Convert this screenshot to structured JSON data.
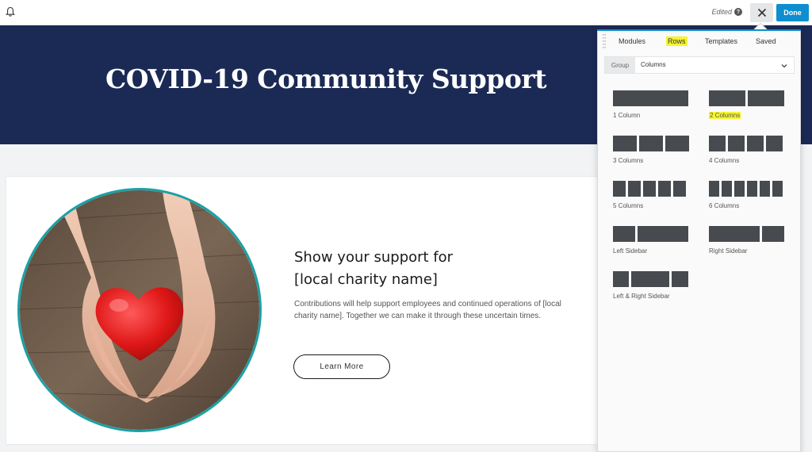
{
  "topbar": {
    "edited_label": "Edited",
    "help_glyph": "?",
    "done_label": "Done",
    "icons": [
      "bell-icon",
      "help-icon",
      "close-icon"
    ]
  },
  "hero": {
    "title": "COVID-19 Community Support"
  },
  "content": {
    "heading_line1": "Show your support for",
    "heading_line2": "[local charity name]",
    "body": "Contributions will help support employees and continued operations of [local charity name]. Together we can make it through these uncertain times.",
    "button_label": "Learn More"
  },
  "panel": {
    "tabs": {
      "modules": "Modules",
      "rows": "Rows",
      "templates": "Templates",
      "saved": "Saved"
    },
    "active_tab": "Rows",
    "group_label": "Group",
    "group_value": "Columns",
    "layouts": {
      "one": "1 Column",
      "two": "2 Columns",
      "three": "3 Columns",
      "four": "4 Columns",
      "five": "5 Columns",
      "six": "6 Columns",
      "left_sidebar": "Left Sidebar",
      "right_sidebar": "Right Sidebar",
      "left_right_sidebar": "Left & Right Sidebar"
    }
  },
  "colors": {
    "hero_bg": "#1b2a55",
    "accent_blue": "#0e8ecf",
    "highlight": "#f4f431",
    "circle_border": "#1aa1a5",
    "block": "#474b4f"
  }
}
